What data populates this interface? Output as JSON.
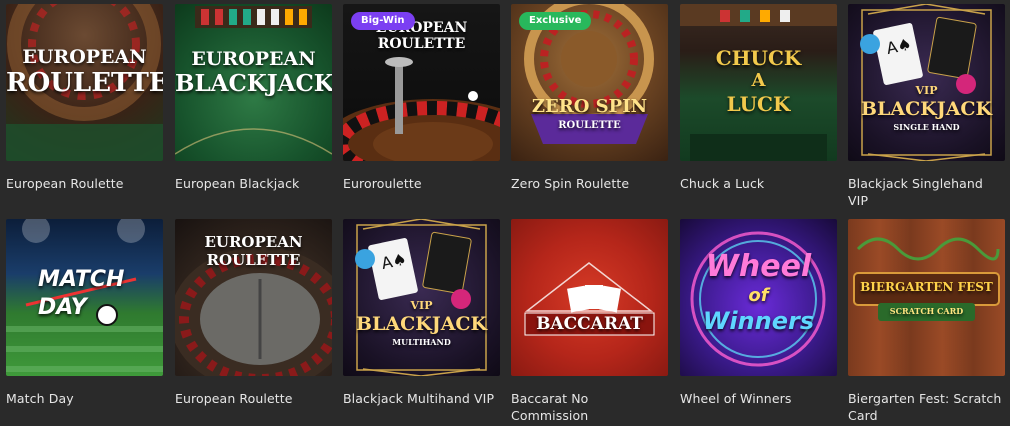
{
  "games": [
    {
      "title": "European Roulette",
      "art_line1": "EUROPEAN",
      "art_line2": "ROULETTE"
    },
    {
      "title": "European Blackjack",
      "art_line1": "EUROPEAN",
      "art_line2": "BLACKJACK"
    },
    {
      "title": "Euroroulette",
      "badge": "Big-Win",
      "art_line1": "EUROPEAN ROULETTE"
    },
    {
      "title": "Zero Spin Roulette",
      "badge": "Exclusive",
      "art_line1": "ZERO SPIN",
      "art_line2": "ROULETTE"
    },
    {
      "title": "Chuck a Luck",
      "art_line1": "CHUCK",
      "art_line2": "A",
      "art_line3": "LUCK"
    },
    {
      "title": "Blackjack Singlehand VIP",
      "art_line1": "VIP",
      "art_line2": "BLACKJACK",
      "art_line3": "SINGLE HAND"
    },
    {
      "title": "Match Day",
      "art_line1": "MATCH",
      "art_line2": "DAY"
    },
    {
      "title": "European Roulette",
      "art_line1": "EUROPEAN ROULETTE"
    },
    {
      "title": "Blackjack Multihand VIP",
      "art_line1": "VIP",
      "art_line2": "BLACKJACK",
      "art_line3": "MULTIHAND"
    },
    {
      "title": "Baccarat No Commission",
      "art_line1": "BACCARAT"
    },
    {
      "title": "Wheel of Winners",
      "art_line1": "Wheel",
      "art_line2": "of",
      "art_line3": "Winners"
    },
    {
      "title": "Biergarten Fest: Scratch Card",
      "art_line1": "BIERGARTEN FEST",
      "art_line2": "SCRATCH CARD"
    }
  ],
  "colors": {
    "background": "#2a2a2a",
    "caption": "#e6e6e6",
    "big_win": "#7b3ff2",
    "exclusive": "#28b85c"
  }
}
